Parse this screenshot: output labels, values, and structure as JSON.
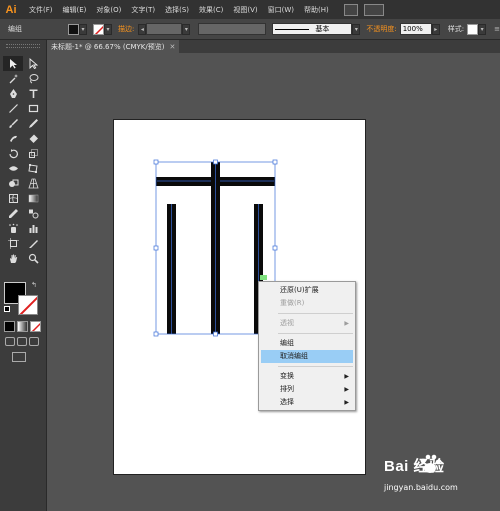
{
  "app": {
    "logo": "Ai",
    "accent_color": "#f7931e"
  },
  "menubar": {
    "items": [
      "文件(F)",
      "编辑(E)",
      "对象(O)",
      "文字(T)",
      "选择(S)",
      "效果(C)",
      "视图(V)",
      "窗口(W)",
      "帮助(H)"
    ]
  },
  "controlbar": {
    "selection_label": "编组",
    "stroke_label": "描边:",
    "brush_label": "基本",
    "opacity_label": "不透明度:",
    "opacity_value": "100%",
    "style_label": "样式:"
  },
  "document": {
    "tab_title": "未标题-1* @ 66.67% (CMYK/预览)",
    "tab_close": "✕"
  },
  "toolbox": {
    "tools": [
      [
        "selection-tool",
        "direct-selection-tool"
      ],
      [
        "magic-wand-tool",
        "lasso-tool"
      ],
      [
        "pen-tool",
        "type-tool"
      ],
      [
        "line-tool",
        "rectangle-tool"
      ],
      [
        "paintbrush-tool",
        "pencil-tool"
      ],
      [
        "blob-brush-tool",
        "eraser-tool"
      ],
      [
        "rotate-tool",
        "scale-tool"
      ],
      [
        "width-tool",
        "free-transform-tool"
      ],
      [
        "shape-builder-tool",
        "perspective-grid-tool"
      ],
      [
        "mesh-tool",
        "gradient-tool"
      ],
      [
        "eyedropper-tool",
        "blend-tool"
      ],
      [
        "symbol-sprayer-tool",
        "column-graph-tool"
      ],
      [
        "artboard-tool",
        "slice-tool"
      ],
      [
        "hand-tool",
        "zoom-tool"
      ]
    ]
  },
  "context_menu": {
    "items": [
      {
        "label": "还原(U)扩展",
        "state": "normal"
      },
      {
        "label": "重做(R)",
        "state": "disabled"
      },
      {
        "sep": true
      },
      {
        "label": "透视",
        "state": "disabled",
        "submenu": true
      },
      {
        "sep": true
      },
      {
        "label": "编组",
        "state": "normal"
      },
      {
        "label": "取消编组",
        "state": "selected"
      },
      {
        "sep": true
      },
      {
        "label": "变换",
        "state": "normal",
        "submenu": true
      },
      {
        "label": "排列",
        "state": "normal",
        "submenu": true
      },
      {
        "label": "选择",
        "state": "normal",
        "submenu": true
      }
    ],
    "submenu_arrow": "▶",
    "highlight_color": "#99cdf5"
  },
  "watermark": {
    "brand": "Bai 经验",
    "url": "jingyan.baidu.com"
  }
}
